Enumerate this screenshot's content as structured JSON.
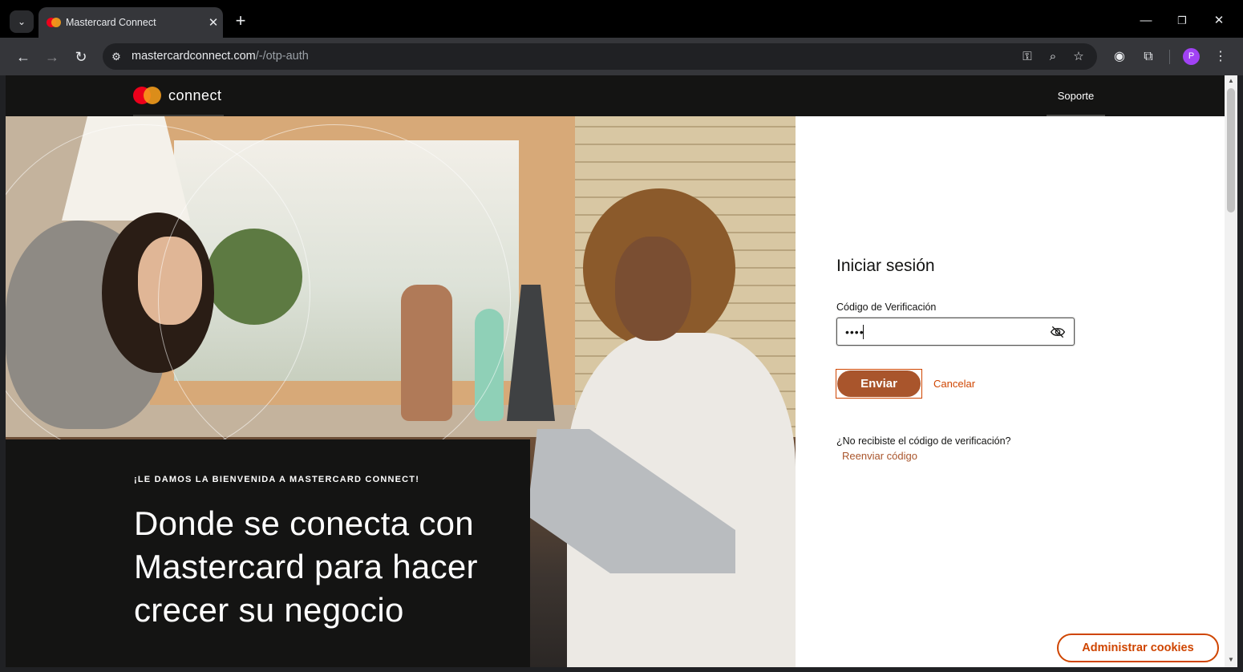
{
  "browser": {
    "tab_title": "Mastercard Connect",
    "tab_search_icon": "chevron-down-icon",
    "new_tab_glyph": "+",
    "window_controls": [
      "—",
      "❐",
      "✕"
    ],
    "url_host": "mastercardconnect.com",
    "url_path": "/-/otp-auth",
    "profile_initial": "P"
  },
  "site": {
    "logo_text": "connect",
    "nav_support": "Soporte",
    "colors": {
      "brand_red": "#eb001b",
      "brand_orange": "#f79e1b",
      "accent": "#cf4500",
      "button_fill": "#a9552c",
      "header_bg": "#141413"
    }
  },
  "welcome": {
    "eyebrow": "¡LE DAMOS LA BIENVENIDA A MASTERCARD CONNECT!",
    "headline": "Donde se conecta con Mastercard para hacer crecer su negocio"
  },
  "login": {
    "title": "Iniciar sesión",
    "code_label": "Código de Verificación",
    "code_value_masked": "••••",
    "submit_label": "Enviar",
    "cancel_label": "Cancelar",
    "resend_question": "¿No recibiste el código de verificación?",
    "resend_link": "Reenviar código"
  },
  "cookies": {
    "button_label": "Administrar cookies"
  }
}
